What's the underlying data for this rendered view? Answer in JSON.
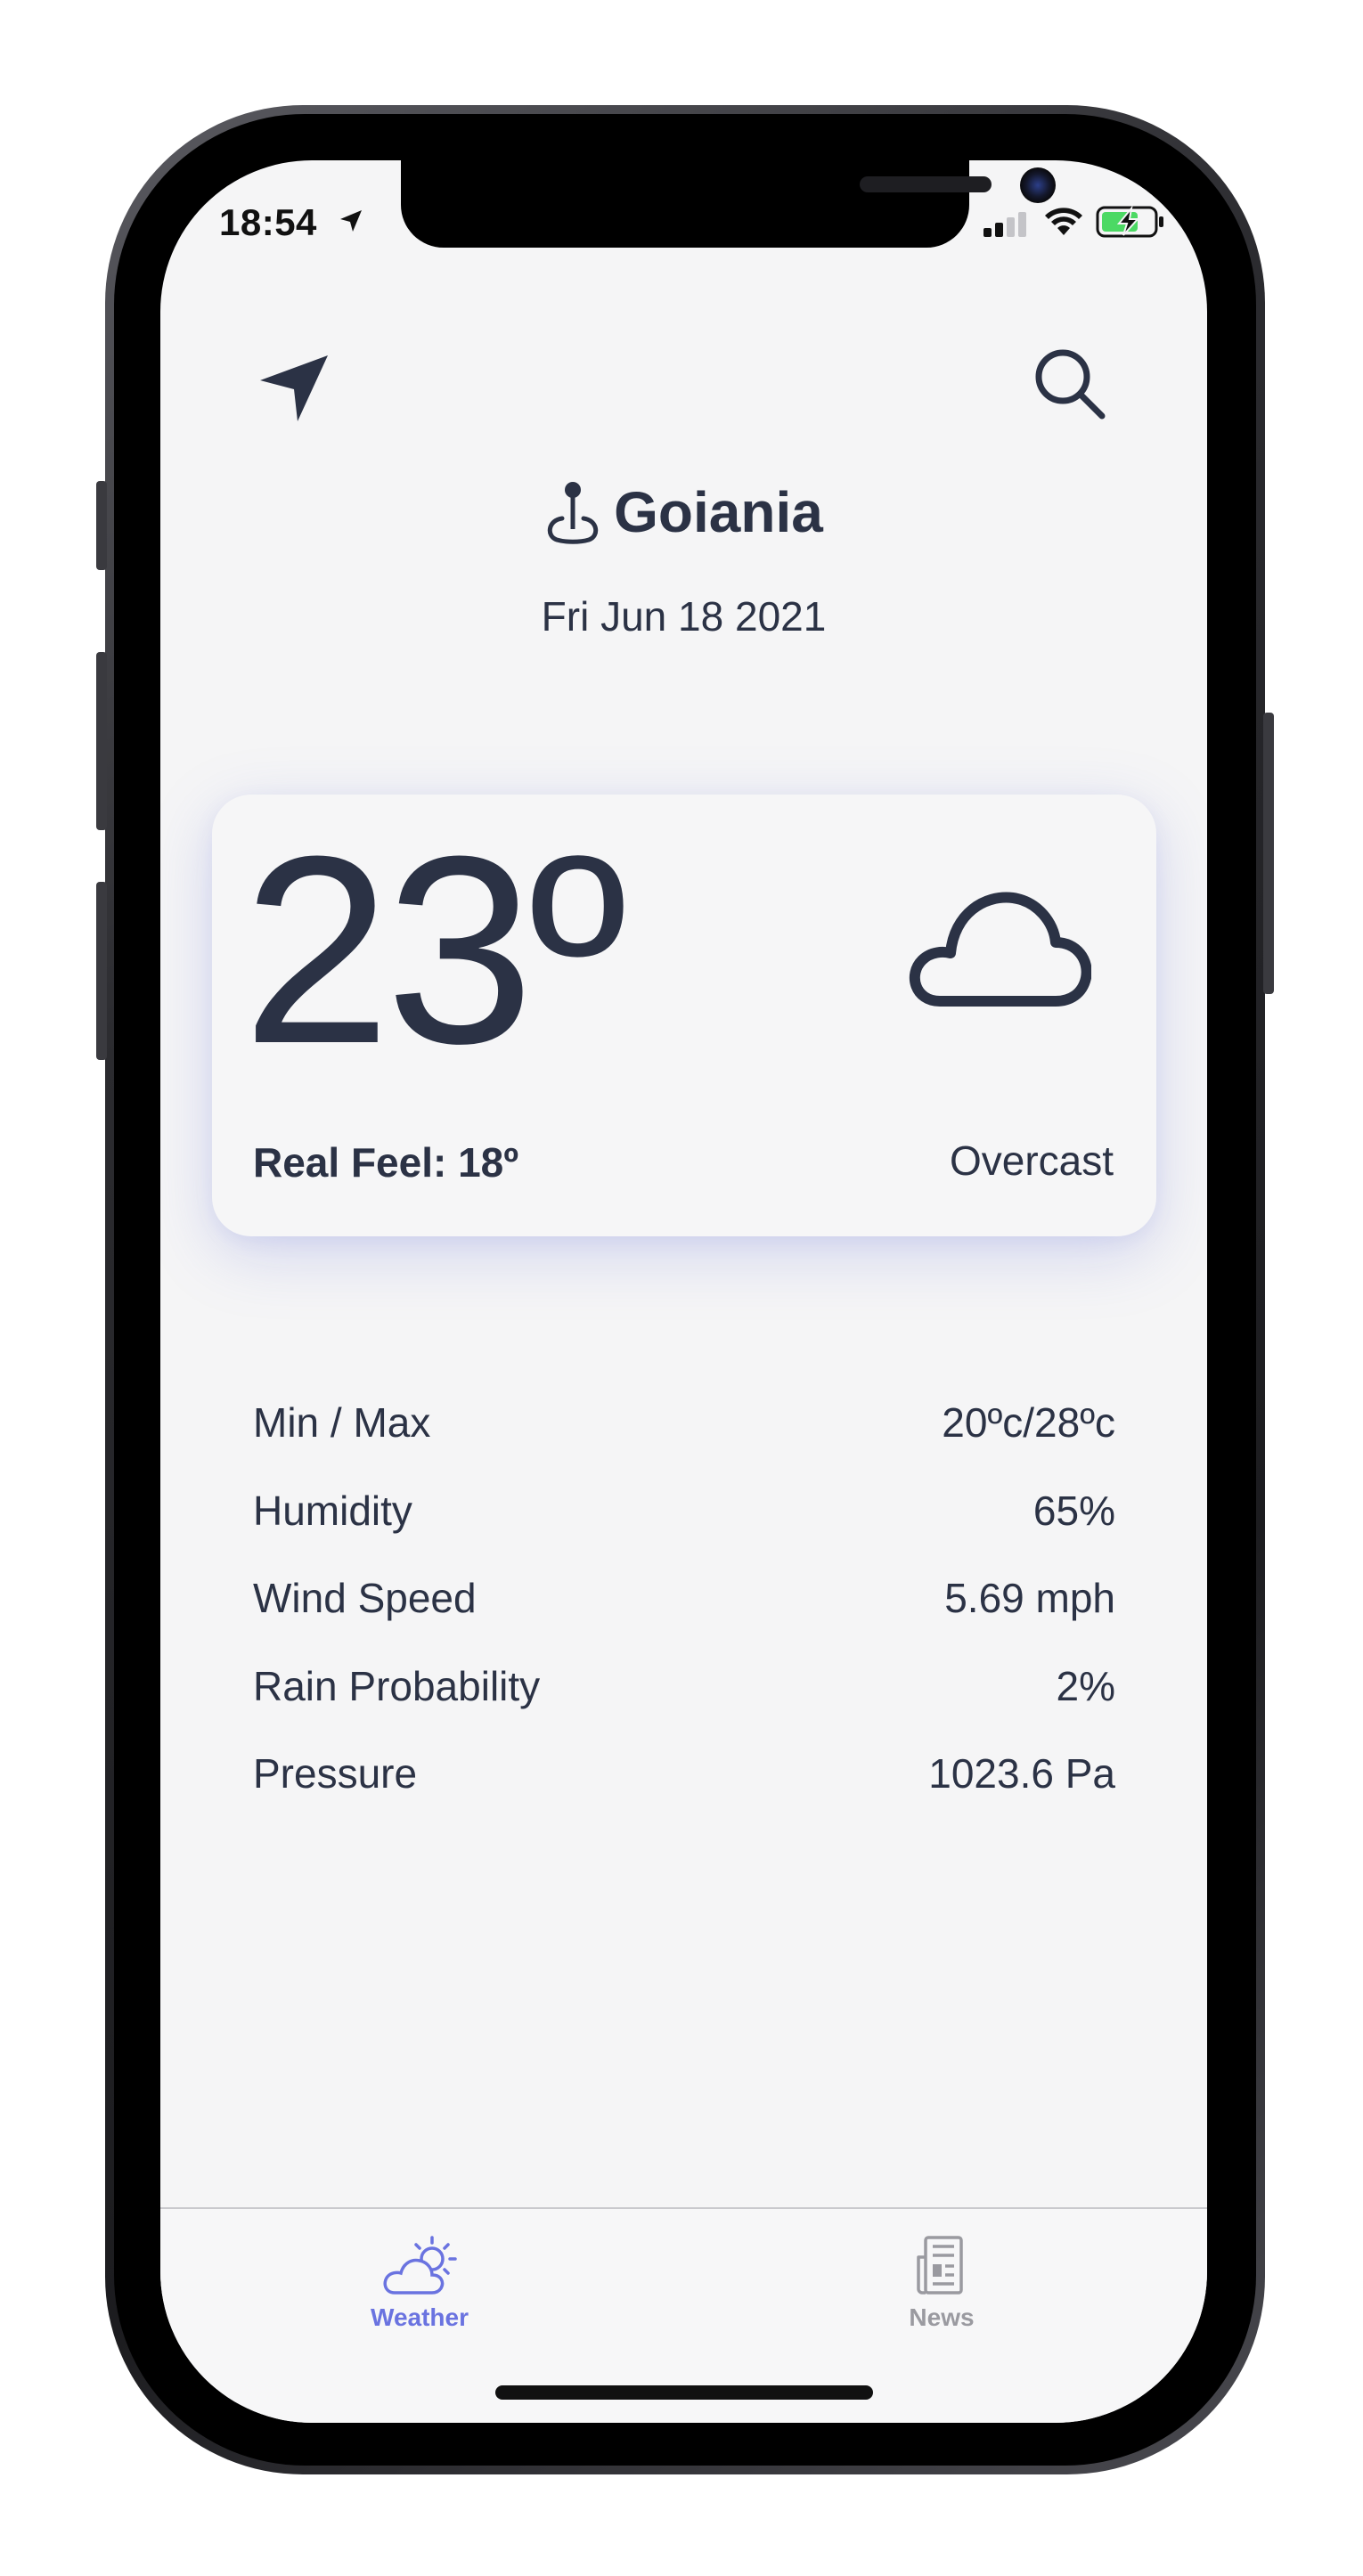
{
  "status_bar": {
    "time": "18:54"
  },
  "location": {
    "city": "Goiania",
    "date": "Fri Jun 18 2021"
  },
  "current": {
    "temperature": "23º",
    "real_feel": "Real Feel: 18º",
    "condition": "Overcast",
    "condition_icon": "cloud-icon"
  },
  "details": [
    {
      "label": "Min / Max",
      "value": "20ºc/28ºc"
    },
    {
      "label": "Humidity",
      "value": "65%"
    },
    {
      "label": "Wind Speed",
      "value": "5.69 mph"
    },
    {
      "label": "Rain Probability",
      "value": "2%"
    },
    {
      "label": "Pressure",
      "value": "1023.6 Pa"
    }
  ],
  "tabbar": {
    "tabs": [
      {
        "label": "Weather",
        "icon": "partly-cloudy-icon",
        "active": true
      },
      {
        "label": "News",
        "icon": "newspaper-icon",
        "active": false
      }
    ]
  },
  "colors": {
    "text": "#2b3245",
    "accent": "#6a73e0",
    "inactive": "#9a9aa0",
    "background": "#f5f5f6"
  }
}
